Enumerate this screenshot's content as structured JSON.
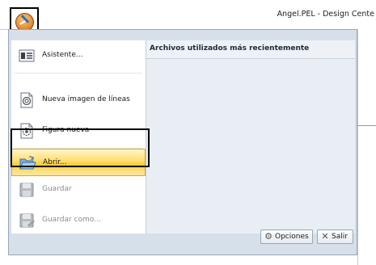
{
  "app": {
    "title": "Angel.PEL - Design Cente"
  },
  "menu": {
    "items": [
      {
        "label": "Asistente...",
        "icon": "wizard-icon",
        "disabled": false
      },
      {
        "label": "Nueva imagen de líneas",
        "icon": "new-line-image-icon",
        "disabled": false
      },
      {
        "label": "Figura nueva",
        "icon": "new-figure-icon",
        "disabled": false
      },
      {
        "label": "Abrir...",
        "icon": "open-folder-icon",
        "disabled": false
      },
      {
        "label": "Guardar",
        "icon": "save-icon",
        "disabled": true
      },
      {
        "label": "Guardar como...",
        "icon": "save-as-icon",
        "disabled": true
      }
    ],
    "recent_title": "Archivos utilizados más recientemente",
    "options_label": "Opciones",
    "exit_label": "Salir"
  }
}
